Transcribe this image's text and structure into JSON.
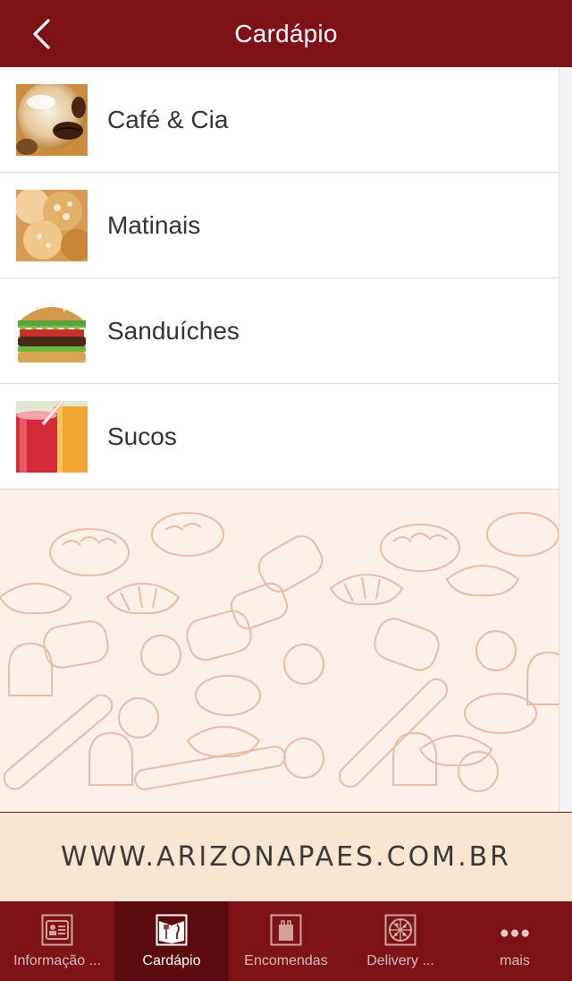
{
  "header": {
    "title": "Cardápio"
  },
  "menu": {
    "items": [
      {
        "label": "Café & Cia",
        "icon": "coffee-photo"
      },
      {
        "label": "Matinais",
        "icon": "bread-photo"
      },
      {
        "label": "Sanduíches",
        "icon": "sandwich-photo"
      },
      {
        "label": "Sucos",
        "icon": "juice-photo"
      }
    ]
  },
  "banner": {
    "text": "WWW.ARIZONAPAES.COM.BR"
  },
  "tabbar": {
    "tabs": [
      {
        "label": "Informação ...",
        "icon": "info-card-icon"
      },
      {
        "label": "Cardápio",
        "icon": "menu-book-icon"
      },
      {
        "label": "Encomendas",
        "icon": "bag-icon"
      },
      {
        "label": "Delivery ...",
        "icon": "pizza-icon"
      },
      {
        "label": "mais",
        "icon": "more-dots-icon"
      }
    ],
    "active": "Cardápio"
  },
  "colors": {
    "brand": "#7d1219",
    "tab_active": "#5c0a10",
    "banner_bg": "#f8e6d2",
    "pattern_bg": "#fdf1ea"
  }
}
